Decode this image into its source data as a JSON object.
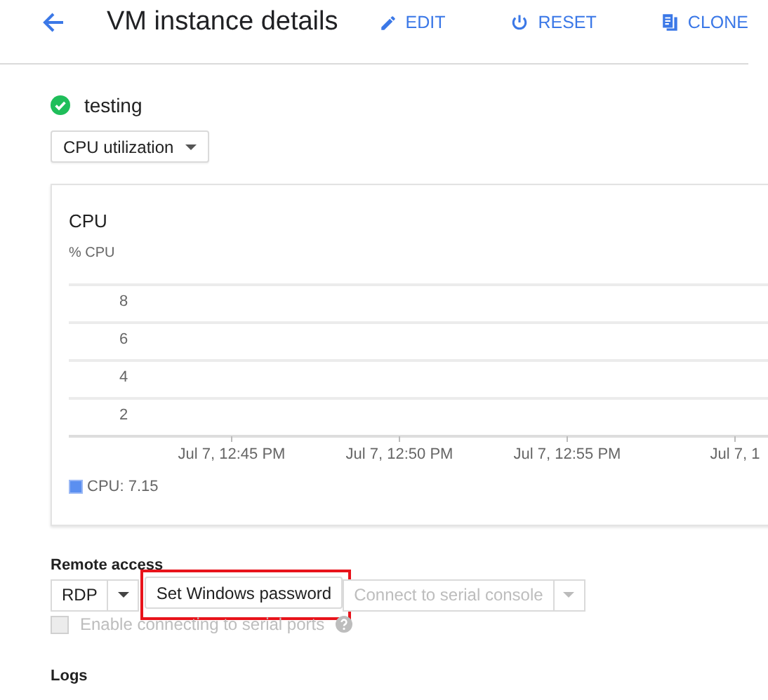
{
  "header": {
    "title": "VM instance details",
    "actions": [
      {
        "kind": "edit",
        "label": "EDIT"
      },
      {
        "kind": "reset",
        "label": "RESET"
      },
      {
        "kind": "clone",
        "label": "CLONE"
      }
    ]
  },
  "instance": {
    "name": "testing",
    "healthy": true
  },
  "metric_select": {
    "value": "CPU utilization"
  },
  "chart_card": {
    "title": "CPU",
    "chart_data": {
      "type": "line",
      "grid": true,
      "ylabel": "% CPU",
      "ylim": [
        0,
        8
      ],
      "yticks": [
        2,
        4,
        6,
        8
      ],
      "categories": [
        "Jul 7, 12:45 PM",
        "Jul 7, 12:50 PM",
        "Jul 7, 12:55 PM",
        "Jul 7, 1"
      ]
    },
    "legend": [
      {
        "label": "CPU: 7.15",
        "color": "#5b8ff0"
      }
    ]
  },
  "remote_access": {
    "label": "Remote access",
    "protocol": "RDP",
    "password_button": {
      "label": "Set Windows password",
      "highlighted": true
    },
    "serial_button": {
      "label": "Connect to serial console",
      "disabled": true
    },
    "serial_checkbox": {
      "label": "Enable connecting to serial ports",
      "checked": false,
      "disabled": true
    }
  },
  "logs": {
    "label": "Logs"
  }
}
